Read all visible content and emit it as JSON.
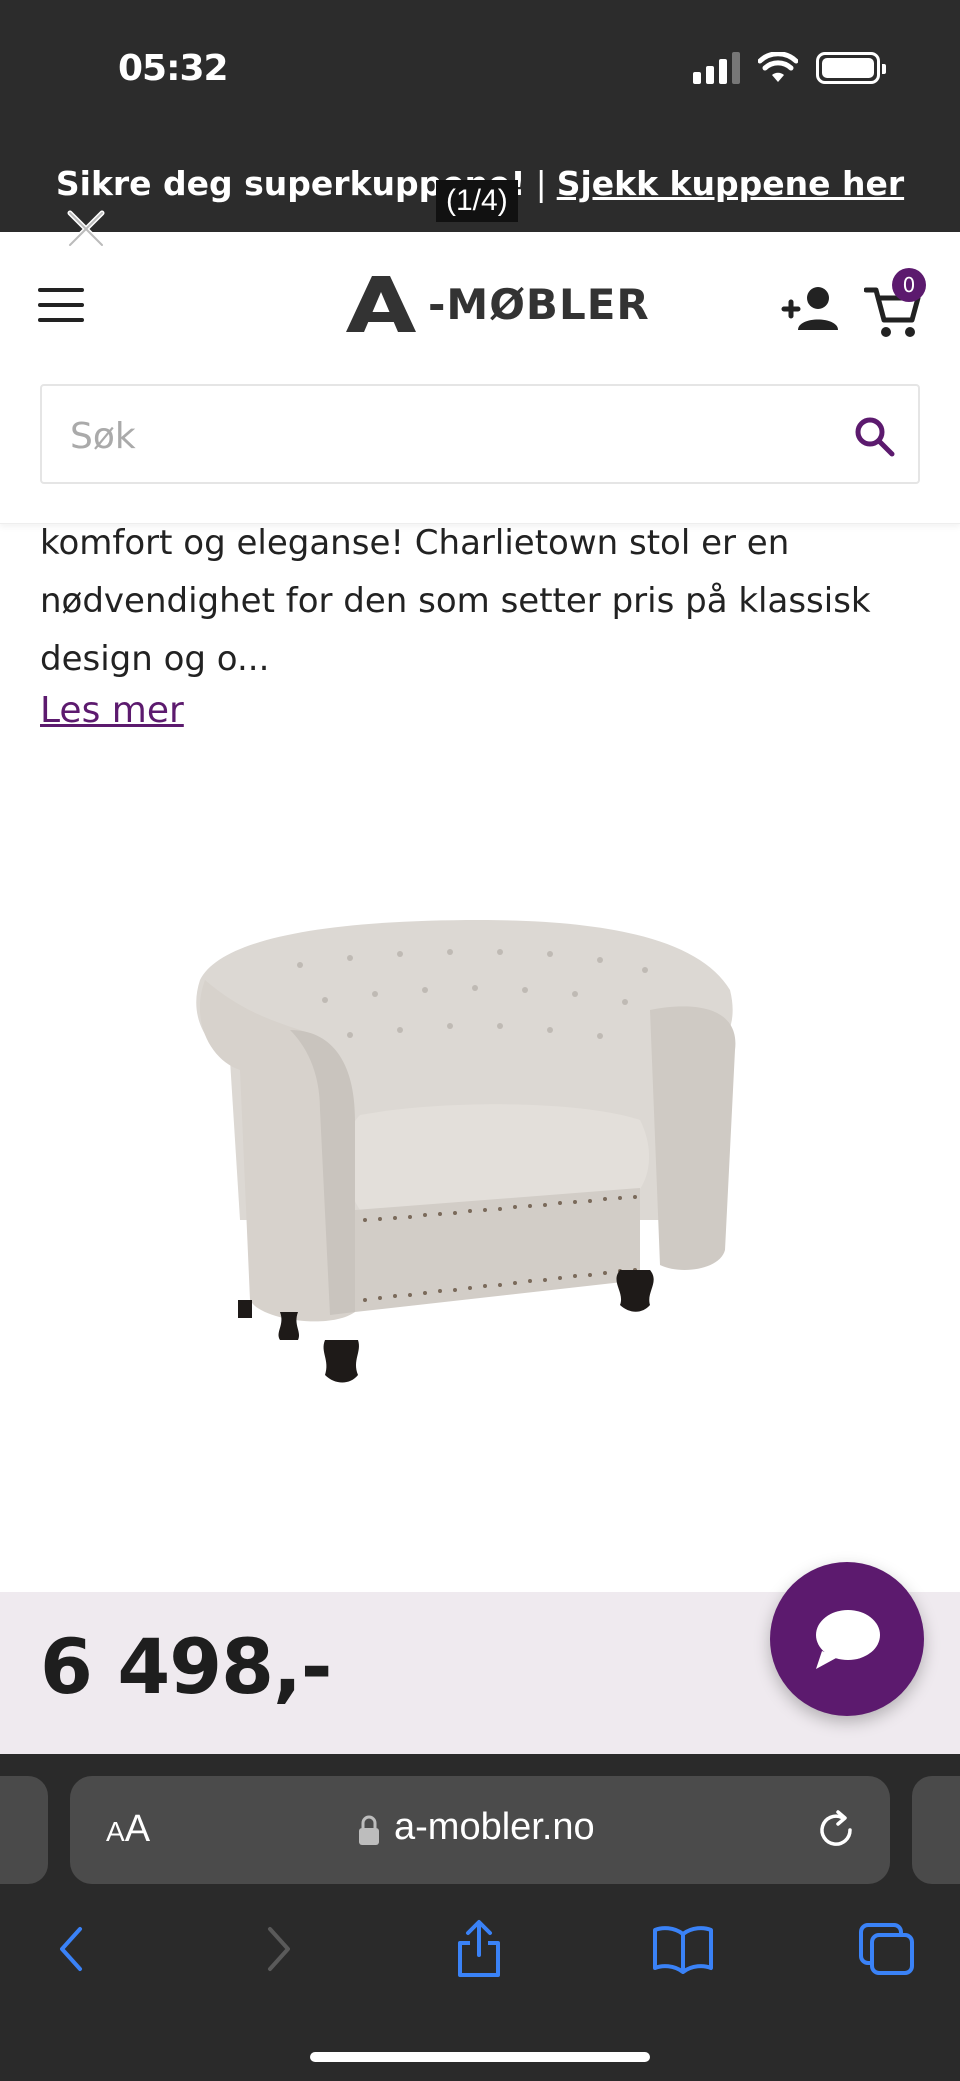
{
  "status_bar": {
    "time": "05:32"
  },
  "promo": {
    "text": "Sikre deg superkuppene!",
    "separator": "|",
    "link_text": "Sjekk kuppene her"
  },
  "header": {
    "logo_text": "-MØBLER",
    "cart_count": "0"
  },
  "search": {
    "placeholder": "Søk"
  },
  "description": {
    "text": "komfort og eleganse! Charlietown stol er en nødvendighet for den som setter pris på klassisk design og o...",
    "read_more": "Les mer"
  },
  "product": {
    "image_alt": "Charlietown stol"
  },
  "price": {
    "value": "6 498,-"
  },
  "browser": {
    "text_size_small": "A",
    "text_size_big": "A",
    "url": "a-mobler.no",
    "page_indicator": "(1/4)"
  },
  "colors": {
    "brand_purple": "#5c1a6e",
    "price_bar_bg": "#efeaef",
    "safari_blue": "#3a82f7"
  }
}
